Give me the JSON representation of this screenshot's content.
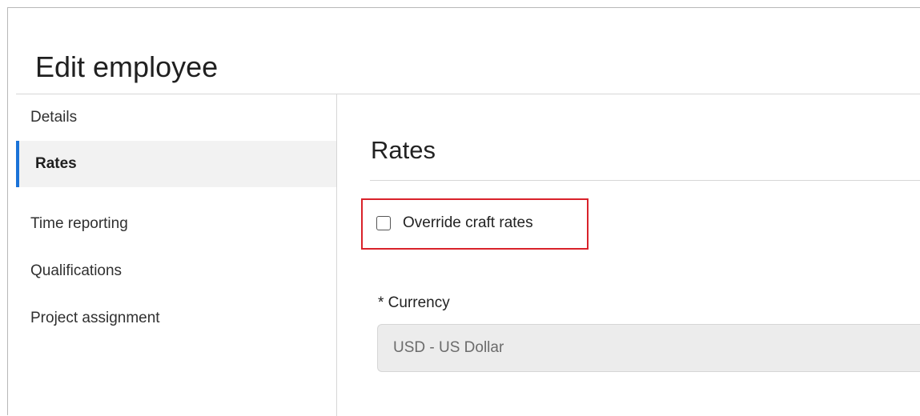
{
  "header": {
    "title": "Edit employee"
  },
  "sidebar": {
    "items": [
      {
        "label": "Details"
      },
      {
        "label": "Rates"
      },
      {
        "label": "Time reporting"
      },
      {
        "label": "Qualifications"
      },
      {
        "label": "Project assignment"
      }
    ],
    "active_item": "Rates",
    "accent_color": "#1a73d8"
  },
  "main": {
    "section_title": "Rates",
    "override_checkbox": {
      "label": "Override craft rates",
      "checked": false,
      "highlight_color": "#d9222a"
    },
    "currency": {
      "label": "* Currency",
      "value": "USD - US Dollar",
      "disabled": true
    }
  }
}
